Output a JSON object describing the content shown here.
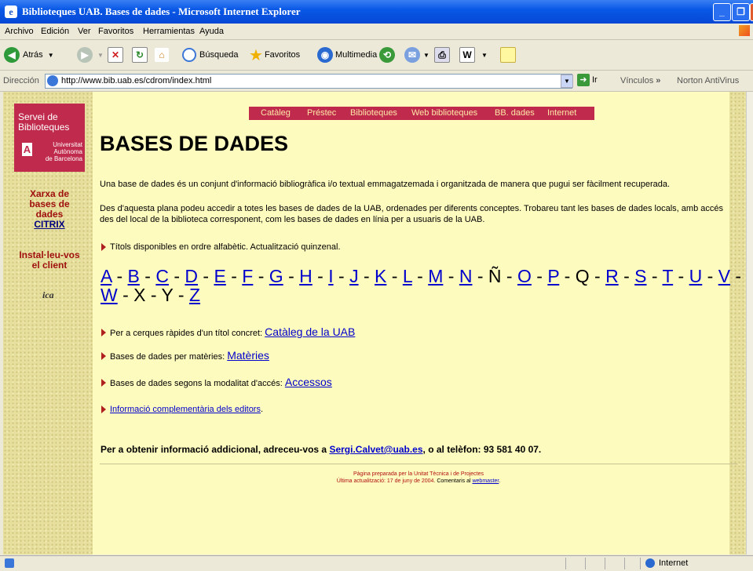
{
  "window": {
    "title": "Biblioteques UAB. Bases de dades - Microsoft Internet Explorer"
  },
  "menu": [
    "Archivo",
    "Edición",
    "Ver",
    "Favoritos",
    "Herramientas",
    "Ayuda"
  ],
  "toolbar": {
    "back": "Atrás",
    "search": "Búsqueda",
    "favorites": "Favoritos",
    "media": "Multimedia"
  },
  "address": {
    "label": "Dirección",
    "url": "http://www.bib.uab.es/cdrom/index.html",
    "go": "Ir",
    "links": "Vínculos",
    "norton": "Norton AntiVirus"
  },
  "sidebar": {
    "logo_line1": "Servei de",
    "logo_line2": "Biblioteques",
    "univ_l1": "Universitat",
    "univ_l2": "Autònoma",
    "univ_l3": "de Barcelona",
    "xarxa_l1": "Xarxa de",
    "xarxa_l2": "bases de",
    "xarxa_l3": "dades",
    "citrix": "CITRIX",
    "install_l1": "Instal·leu-vos",
    "install_l2": "el client",
    "ica": "ica"
  },
  "nav": [
    "Catàleg",
    "Préstec",
    "Biblioteques",
    "Web biblioteques",
    "BB. dades",
    "Internet"
  ],
  "page": {
    "title": "BASES DE DADES",
    "intro": "Una base de dades és un conjunt d'informació bibliogràfica i/o textual emmagatzemada i organitzada de manera que pugui ser fàcilment recuperada.",
    "desc": "Des d'aquesta plana podeu accedir a totes les bases de dades de la UAB, ordenades per diferents conceptes. Trobareu tant les bases de dades locals, amb accés des del local de la biblioteca corresponent, com les bases de dades en línia per a usuaris de la UAB.",
    "alpha_intro": "Títols disponibles en ordre alfabètic. Actualització quinzenal.",
    "letters": [
      {
        "l": "A",
        "link": true
      },
      {
        "l": "B",
        "link": true
      },
      {
        "l": "C",
        "link": true
      },
      {
        "l": "D",
        "link": true
      },
      {
        "l": "E",
        "link": true
      },
      {
        "l": "F",
        "link": true
      },
      {
        "l": "G",
        "link": true
      },
      {
        "l": "H",
        "link": true
      },
      {
        "l": "I",
        "link": true
      },
      {
        "l": "J",
        "link": true
      },
      {
        "l": "K",
        "link": true
      },
      {
        "l": "L",
        "link": true
      },
      {
        "l": "M",
        "link": true
      },
      {
        "l": "N",
        "link": true
      },
      {
        "l": "Ñ",
        "link": false
      },
      {
        "l": "O",
        "link": true
      },
      {
        "l": "P",
        "link": true
      },
      {
        "l": "Q",
        "link": false
      },
      {
        "l": "R",
        "link": true
      },
      {
        "l": "S",
        "link": true
      },
      {
        "l": "T",
        "link": true
      },
      {
        "l": "U",
        "link": true
      },
      {
        "l": "V",
        "link": true
      },
      {
        "l": "W",
        "link": true
      },
      {
        "l": "X",
        "link": false
      },
      {
        "l": "Y",
        "link": false
      },
      {
        "l": "Z",
        "link": true
      }
    ],
    "quick_text": "Per a cerques ràpides d'un títol concret:",
    "quick_link": "Catàleg de la UAB",
    "subj_text": "Bases de dades per matèries:",
    "subj_link": "Matèries",
    "access_text": "Bases de dades segons la modalitat d'accés:",
    "access_link": "Accessos",
    "editors_link": "Informació complementària dels editors",
    "editors_end": ".",
    "info_pre": "Per a obtenir informació addicional, adreceu-vos a",
    "info_email": "Sergi.Calvet@uab.es",
    "info_post": ", o al telèfon: 93 581 40 07.",
    "footer_l1": "Pàgina preparada per la Unitat Tècnica i de Projectes",
    "footer_l2a": "Última actualització: 17 de juny de 2004.",
    "footer_l2b": "Comentaris al",
    "footer_webmaster": "webmaster",
    "footer_end": "."
  },
  "status": {
    "zone": "Internet"
  }
}
